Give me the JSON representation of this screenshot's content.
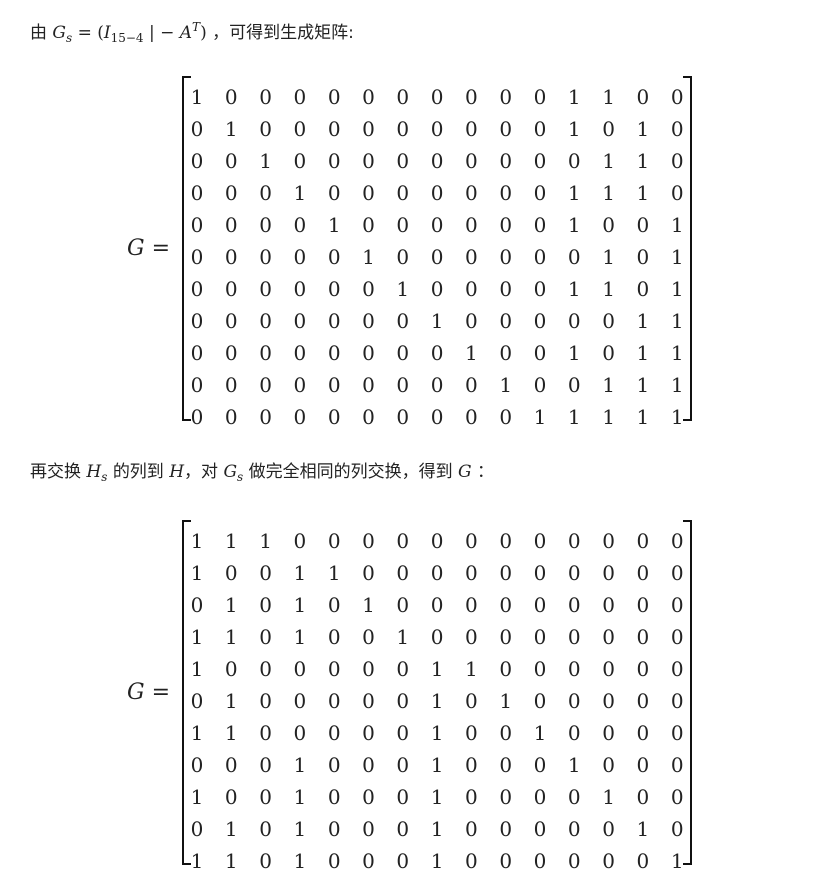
{
  "intro": {
    "prefix": "由",
    "gs_letter": "G",
    "gs_sub": "s",
    "eq": "=",
    "open": "(",
    "i_letter": "I",
    "i_sub": "15−4",
    "bar": "|",
    "minus": "−",
    "a_letter": "A",
    "a_sup": "T",
    "close": ")",
    "suffix": "，可得到生成矩阵:"
  },
  "matrix1": {
    "label": "G =",
    "rows": [
      [
        "1",
        "0",
        "0",
        "0",
        "0",
        "0",
        "0",
        "0",
        "0",
        "0",
        "0",
        "1",
        "1",
        "0",
        "0"
      ],
      [
        "0",
        "1",
        "0",
        "0",
        "0",
        "0",
        "0",
        "0",
        "0",
        "0",
        "0",
        "1",
        "0",
        "1",
        "0"
      ],
      [
        "0",
        "0",
        "1",
        "0",
        "0",
        "0",
        "0",
        "0",
        "0",
        "0",
        "0",
        "0",
        "1",
        "1",
        "0"
      ],
      [
        "0",
        "0",
        "0",
        "1",
        "0",
        "0",
        "0",
        "0",
        "0",
        "0",
        "0",
        "1",
        "1",
        "1",
        "0"
      ],
      [
        "0",
        "0",
        "0",
        "0",
        "1",
        "0",
        "0",
        "0",
        "0",
        "0",
        "0",
        "1",
        "0",
        "0",
        "1"
      ],
      [
        "0",
        "0",
        "0",
        "0",
        "0",
        "1",
        "0",
        "0",
        "0",
        "0",
        "0",
        "0",
        "1",
        "0",
        "1"
      ],
      [
        "0",
        "0",
        "0",
        "0",
        "0",
        "0",
        "1",
        "0",
        "0",
        "0",
        "0",
        "1",
        "1",
        "0",
        "1"
      ],
      [
        "0",
        "0",
        "0",
        "0",
        "0",
        "0",
        "0",
        "1",
        "0",
        "0",
        "0",
        "0",
        "0",
        "1",
        "1"
      ],
      [
        "0",
        "0",
        "0",
        "0",
        "0",
        "0",
        "0",
        "0",
        "1",
        "0",
        "0",
        "1",
        "0",
        "1",
        "1"
      ],
      [
        "0",
        "0",
        "0",
        "0",
        "0",
        "0",
        "0",
        "0",
        "0",
        "1",
        "0",
        "0",
        "1",
        "1",
        "1"
      ],
      [
        "0",
        "0",
        "0",
        "0",
        "0",
        "0",
        "0",
        "0",
        "0",
        "0",
        "1",
        "1",
        "1",
        "1",
        "1"
      ]
    ]
  },
  "middle": {
    "p1": "再交换",
    "hs_letter": "H",
    "hs_sub": "s",
    "p2": "的列到",
    "h_letter": "H",
    "p3": "，对",
    "gs_letter": "G",
    "gs_sub": "s",
    "p4": "做完全相同的列交换，得到",
    "g_letter": "G",
    "p5": "："
  },
  "matrix2": {
    "label": "G =",
    "rows": [
      [
        "1",
        "1",
        "1",
        "0",
        "0",
        "0",
        "0",
        "0",
        "0",
        "0",
        "0",
        "0",
        "0",
        "0",
        "0"
      ],
      [
        "1",
        "0",
        "0",
        "1",
        "1",
        "0",
        "0",
        "0",
        "0",
        "0",
        "0",
        "0",
        "0",
        "0",
        "0"
      ],
      [
        "0",
        "1",
        "0",
        "1",
        "0",
        "1",
        "0",
        "0",
        "0",
        "0",
        "0",
        "0",
        "0",
        "0",
        "0"
      ],
      [
        "1",
        "1",
        "0",
        "1",
        "0",
        "0",
        "1",
        "0",
        "0",
        "0",
        "0",
        "0",
        "0",
        "0",
        "0"
      ],
      [
        "1",
        "0",
        "0",
        "0",
        "0",
        "0",
        "0",
        "1",
        "1",
        "0",
        "0",
        "0",
        "0",
        "0",
        "0"
      ],
      [
        "0",
        "1",
        "0",
        "0",
        "0",
        "0",
        "0",
        "1",
        "0",
        "1",
        "0",
        "0",
        "0",
        "0",
        "0"
      ],
      [
        "1",
        "1",
        "0",
        "0",
        "0",
        "0",
        "0",
        "1",
        "0",
        "0",
        "1",
        "0",
        "0",
        "0",
        "0"
      ],
      [
        "0",
        "0",
        "0",
        "1",
        "0",
        "0",
        "0",
        "1",
        "0",
        "0",
        "0",
        "1",
        "0",
        "0",
        "0"
      ],
      [
        "1",
        "0",
        "0",
        "1",
        "0",
        "0",
        "0",
        "1",
        "0",
        "0",
        "0",
        "0",
        "1",
        "0",
        "0"
      ],
      [
        "0",
        "1",
        "0",
        "1",
        "0",
        "0",
        "0",
        "1",
        "0",
        "0",
        "0",
        "0",
        "0",
        "1",
        "0"
      ],
      [
        "1",
        "1",
        "0",
        "1",
        "0",
        "0",
        "0",
        "1",
        "0",
        "0",
        "0",
        "0",
        "0",
        "0",
        "1"
      ]
    ]
  }
}
